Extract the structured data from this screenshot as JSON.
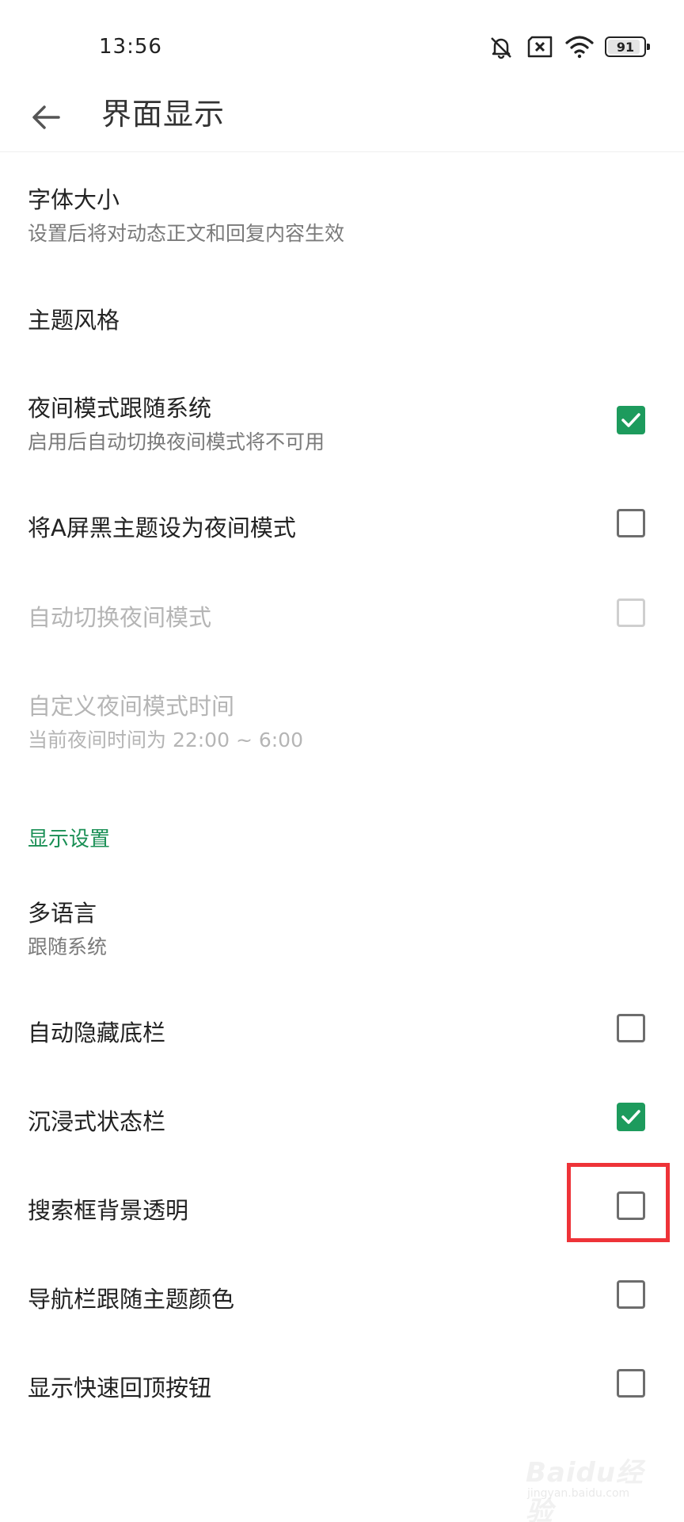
{
  "status_bar": {
    "time": "13:56",
    "battery": "91",
    "battery_fraction": 0.91,
    "icons": [
      "bell-muted-icon",
      "sim-blocked-icon",
      "wifi-icon",
      "battery-icon"
    ]
  },
  "app_bar": {
    "back_icon": "arrow-left-icon",
    "title": "界面显示"
  },
  "settings": {
    "font_size": {
      "title": "字体大小",
      "subtitle": "设置后将对动态正文和回复内容生效"
    },
    "theme_style": {
      "title": "主题风格"
    },
    "night_follow_system": {
      "title": "夜间模式跟随系统",
      "subtitle": "启用后自动切换夜间模式将不可用",
      "checked": true
    },
    "a_black_theme_night": {
      "title": "将A屏黑主题设为夜间模式",
      "checked": false
    },
    "auto_switch_night": {
      "title": "自动切换夜间模式",
      "checked": false,
      "disabled": true
    },
    "custom_night_time": {
      "title": "自定义夜间模式时间",
      "subtitle": "当前夜间时间为 22:00 ~ 6:00",
      "disabled": true
    }
  },
  "display_section": {
    "header": "显示设置",
    "language": {
      "title": "多语言",
      "subtitle": "跟随系统"
    },
    "auto_hide_bottom_bar": {
      "title": "自动隐藏底栏",
      "checked": false
    },
    "immersive_status_bar": {
      "title": "沉浸式状态栏",
      "checked": true
    },
    "search_box_transparent": {
      "title": "搜索框背景透明",
      "checked": false
    },
    "nav_bar_follow_theme": {
      "title": "导航栏跟随主题颜色",
      "checked": false
    },
    "show_back_to_top": {
      "title": "显示快速回顶按钮",
      "checked": false
    }
  },
  "colors": {
    "accent": "#1d9b5d",
    "section_header": "#1a8f55",
    "highlight": "#ee3338"
  },
  "watermark": {
    "text": "Baidu经验",
    "sub": "jingyan.baidu.com"
  }
}
